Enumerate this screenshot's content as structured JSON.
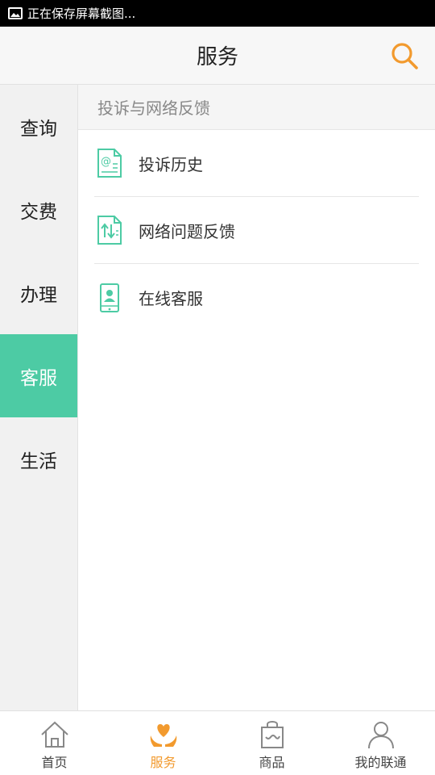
{
  "status_bar": {
    "text": "正在保存屏幕截图..."
  },
  "header": {
    "title": "服务"
  },
  "sidebar": {
    "items": [
      {
        "label": "查询"
      },
      {
        "label": "交费"
      },
      {
        "label": "办理"
      },
      {
        "label": "客服",
        "active": true
      },
      {
        "label": "生活"
      }
    ]
  },
  "content": {
    "section_title": "投诉与网络反馈",
    "items": [
      {
        "label": "投诉历史",
        "icon": "email-document-icon"
      },
      {
        "label": "网络问题反馈",
        "icon": "network-transfer-icon"
      },
      {
        "label": "在线客服",
        "icon": "phone-person-icon"
      }
    ]
  },
  "tabbar": {
    "tabs": [
      {
        "label": "首页",
        "icon": "home-icon"
      },
      {
        "label": "服务",
        "icon": "heart-hands-icon",
        "active": true
      },
      {
        "label": "商品",
        "icon": "shopping-bag-icon"
      },
      {
        "label": "我的联通",
        "icon": "user-icon"
      }
    ]
  },
  "colors": {
    "accent": "#4dcba4",
    "active_tab": "#f29a2e",
    "search_icon": "#f29a2e"
  }
}
